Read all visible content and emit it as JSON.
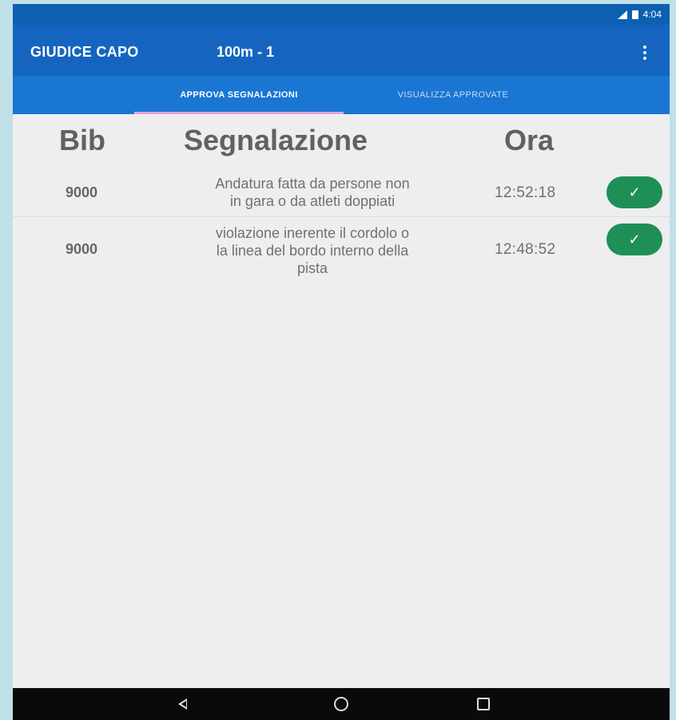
{
  "status_bar": {
    "time": "4:04",
    "icons": [
      "signal-icon",
      "battery-icon"
    ]
  },
  "app_bar": {
    "title": "GIUDICE CAPO",
    "subtitle": "100m - 1",
    "menu_icon": "overflow-menu-icon"
  },
  "tabs": [
    {
      "label": "APPROVA SEGNALAZIONI",
      "selected": true
    },
    {
      "label": "VISUALIZZA APPROVATE",
      "selected": false
    }
  ],
  "table": {
    "headers": {
      "bib": "Bib",
      "segnalazione": "Segnalazione",
      "ora": "Ora"
    },
    "rows": [
      {
        "bib": "9000",
        "segnalazione_lines": [
          "Andatura fatta da persone non",
          "in gara o da atleti doppiati"
        ],
        "ora": "12:52:18",
        "action_icon": "check-icon"
      },
      {
        "bib": "9000",
        "segnalazione_lines": [
          "violazione inerente il cordolo o",
          "la linea del bordo interno della",
          "pista"
        ],
        "ora": "12:48:52",
        "action_icon": "check-icon"
      }
    ],
    "check_glyph": "✓"
  },
  "nav_bar": {
    "buttons": [
      "back-icon",
      "home-icon",
      "recents-icon"
    ]
  },
  "colors": {
    "status_bar": "#0d5fb0",
    "app_bar": "#1565c0",
    "tab_bar": "#1976d2",
    "tab_indicator": "#e0a6d9",
    "approve_button": "#1e8f57",
    "background": "#eeeeee"
  }
}
